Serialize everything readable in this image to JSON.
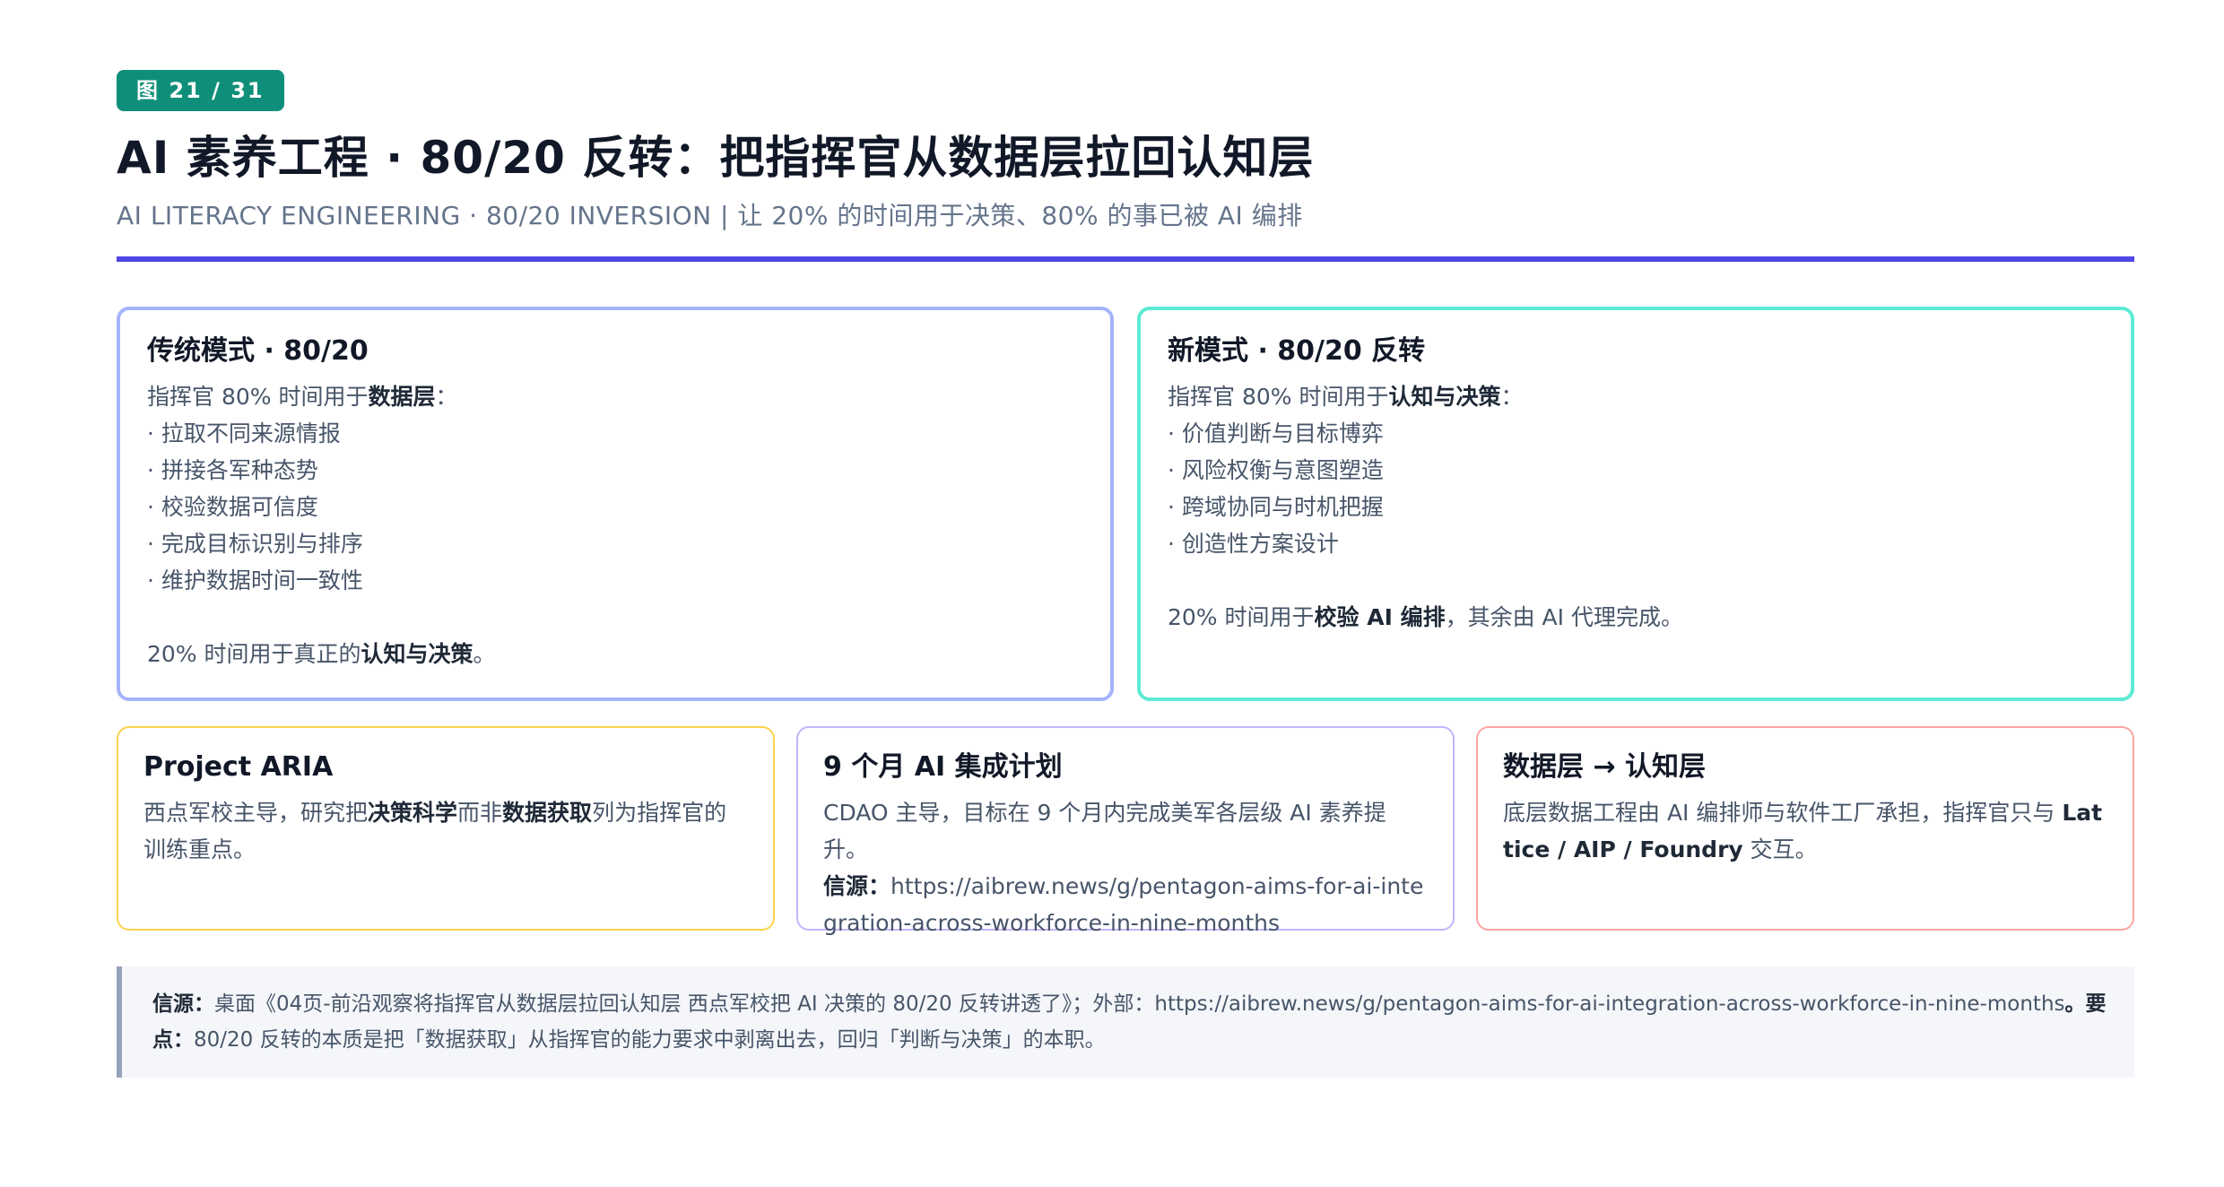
{
  "badge": "图 21 / 31",
  "title": "AI 素养工程 · 80/20 反转：把指挥官从数据层拉回认知层",
  "subtitle": "AI LITERACY ENGINEERING · 80/20 INVERSION | 让 20% 的时间用于决策、80% 的事已被 AI 编排",
  "accent_color": "#4f46e5",
  "traditional": {
    "title": "传统模式 · 80/20",
    "intro_prefix": "指挥官 80% 时间用于",
    "intro_bold": "数据层",
    "intro_suffix": "：",
    "items": [
      "· 拉取不同来源情报",
      "· 拼接各军种态势",
      "· 校验数据可信度",
      "· 完成目标识别与排序",
      "· 维护数据时间一致性"
    ],
    "outro_prefix": "20% 时间用于真正的",
    "outro_bold": "认知与决策",
    "outro_suffix": "。"
  },
  "new_mode": {
    "title": "新模式 · 80/20 反转",
    "intro_prefix": "指挥官 80% 时间用于",
    "intro_bold": "认知与决策",
    "intro_suffix": "：",
    "items": [
      "· 价值判断与目标博弈",
      "· 风险权衡与意图塑造",
      "· 跨域协同与时机把握",
      "· 创造性方案设计"
    ],
    "outro_prefix": "20% 时间用于",
    "outro_bold": "校验 AI 编排",
    "outro_suffix": "，其余由 AI 代理完成。"
  },
  "aria": {
    "title": "Project ARIA",
    "text_prefix": "西点军校主导，研究把",
    "text_bold1": "决策科学",
    "text_mid": "而非",
    "text_bold2": "数据获取",
    "text_suffix": "列为指挥官的训练重点。"
  },
  "nine_month": {
    "title": "9 个月 AI 集成计划",
    "text": "CDAO 主导，目标在 9 个月内完成美军各层级 AI 素养提升。",
    "source_label": "信源：",
    "source_url": "https://aibrew.news/g/pentagon-aims-for-ai-integration-across-workforce-in-nine-months"
  },
  "layer": {
    "title": "数据层 → 认知层",
    "text_prefix": "底层数据工程由 AI 编排师与软件工厂承担，指挥官只与 ",
    "text_bold": "Lattice / AIP / Foundry",
    "text_suffix": " 交互。"
  },
  "note": {
    "source_label": "信源：",
    "source_text": "桌面《04页-前沿观察将指挥官从数据层拉回认知层 西点军校把 AI 决策的 80/20 反转讲透了》；外部：https://aibrew.news/g/pentagon-aims-for-ai-integration-across-workforce-in-nine-months",
    "key_label": "。要点：",
    "key_text": "80/20 反转的本质是把「数据获取」从指挥官的能力要求中剥离出去，回归「判断与决策」的本职。"
  }
}
